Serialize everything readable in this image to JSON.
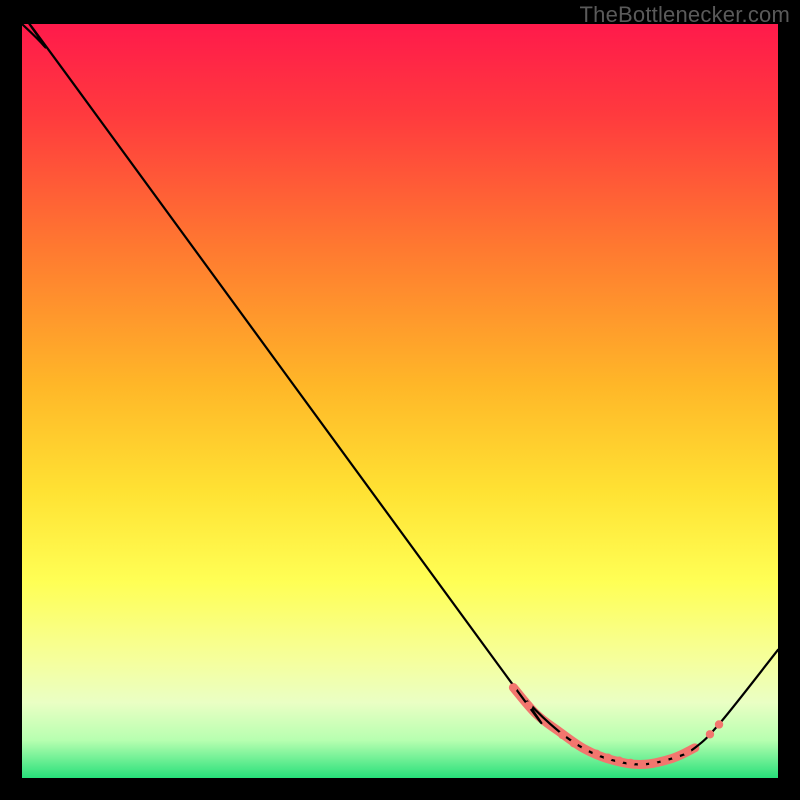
{
  "watermark": "TheBottlenecker.com",
  "chart_data": {
    "type": "line",
    "title": "",
    "xlabel": "",
    "ylabel": "",
    "xlim": [
      0,
      100
    ],
    "ylim": [
      0,
      100
    ],
    "gradient_stops": [
      {
        "offset": 0,
        "color": "#ff1a4b"
      },
      {
        "offset": 12,
        "color": "#ff3a3e"
      },
      {
        "offset": 30,
        "color": "#ff7a30"
      },
      {
        "offset": 48,
        "color": "#ffb728"
      },
      {
        "offset": 62,
        "color": "#ffe233"
      },
      {
        "offset": 74,
        "color": "#ffff55"
      },
      {
        "offset": 84,
        "color": "#f6ff9a"
      },
      {
        "offset": 90,
        "color": "#eaffc4"
      },
      {
        "offset": 95,
        "color": "#b7ffb0"
      },
      {
        "offset": 100,
        "color": "#27e07a"
      }
    ],
    "series": [
      {
        "name": "curve",
        "stroke": "#000000",
        "stroke_width": 2.2,
        "points": [
          {
            "x": 0.0,
            "y": 100.0
          },
          {
            "x": 3.0,
            "y": 97.0
          },
          {
            "x": 6.5,
            "y": 92.5
          },
          {
            "x": 63.0,
            "y": 15.0
          },
          {
            "x": 67.0,
            "y": 10.0
          },
          {
            "x": 71.0,
            "y": 6.2
          },
          {
            "x": 74.5,
            "y": 3.8
          },
          {
            "x": 78.0,
            "y": 2.4
          },
          {
            "x": 82.0,
            "y": 1.8
          },
          {
            "x": 86.0,
            "y": 2.6
          },
          {
            "x": 89.0,
            "y": 4.0
          },
          {
            "x": 92.5,
            "y": 7.5
          },
          {
            "x": 100.0,
            "y": 17.0
          }
        ]
      },
      {
        "name": "highlight",
        "stroke": "#f2766e",
        "stroke_width": 9,
        "points": [
          {
            "x": 65.0,
            "y": 12.0
          },
          {
            "x": 68.0,
            "y": 8.5
          },
          {
            "x": 71.0,
            "y": 6.2
          },
          {
            "x": 74.5,
            "y": 3.8
          },
          {
            "x": 78.0,
            "y": 2.4
          },
          {
            "x": 82.0,
            "y": 1.8
          },
          {
            "x": 86.0,
            "y": 2.6
          },
          {
            "x": 89.0,
            "y": 4.0
          }
        ]
      }
    ],
    "highlight_dots": {
      "fill": "#f2766e",
      "radius": 4.2,
      "points": [
        {
          "x": 65.0,
          "y": 12.0
        },
        {
          "x": 67.0,
          "y": 9.6
        },
        {
          "x": 71.5,
          "y": 5.7
        },
        {
          "x": 73.0,
          "y": 4.6
        },
        {
          "x": 74.5,
          "y": 3.8
        },
        {
          "x": 76.0,
          "y": 3.2
        },
        {
          "x": 77.5,
          "y": 2.7
        },
        {
          "x": 79.0,
          "y": 2.3
        },
        {
          "x": 80.5,
          "y": 2.0
        },
        {
          "x": 82.0,
          "y": 1.8
        },
        {
          "x": 83.5,
          "y": 1.9
        },
        {
          "x": 85.0,
          "y": 2.3
        },
        {
          "x": 86.5,
          "y": 2.8
        },
        {
          "x": 88.0,
          "y": 3.5
        },
        {
          "x": 91.0,
          "y": 5.8
        },
        {
          "x": 92.2,
          "y": 7.1
        }
      ]
    }
  }
}
